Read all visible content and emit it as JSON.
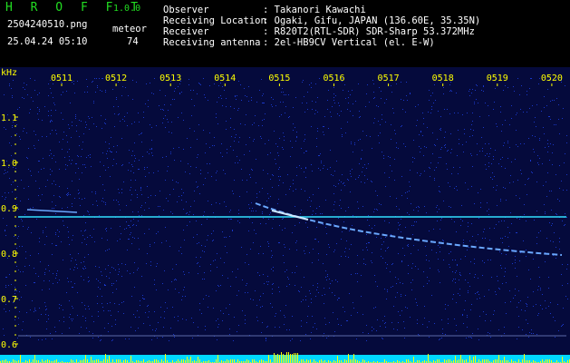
{
  "header": {
    "app_title": "H R O F F T",
    "app_version": "1.0.0",
    "file_name": "2504240510.png",
    "timestamp": "25.04.24 05:10",
    "meteor_label": "meteor",
    "meteor_count": "74",
    "info": [
      {
        "label": "Observer",
        "value": ": Takanori Kawachi"
      },
      {
        "label": "Receiving Location",
        "value": ": Ogaki, Gifu, JAPAN (136.60E, 35.35N)"
      },
      {
        "label": "Receiver",
        "value": ": R820T2(RTL-SDR) SDR-Sharp 53.372MHz"
      },
      {
        "label": "Receiving antenna",
        "value": ": 2el-HB9CV Vertical (el. E-W)"
      }
    ]
  },
  "spectrogram": {
    "y_unit": "kHz",
    "time_labels": [
      "0511",
      "0512",
      "0513",
      "0514",
      "0515",
      "0516",
      "0517",
      "0518",
      "0519",
      "0520"
    ],
    "freq_labels": [
      "1.1",
      "1.0",
      "0.9",
      "0.8",
      "0.7",
      "0.6"
    ],
    "freq_values": [
      1.1,
      1.0,
      0.9,
      0.8,
      0.7,
      0.6
    ],
    "colors": {
      "background": "#050a3c",
      "noise": "#1a38c8",
      "carrier": "#33e0ff",
      "axis_text": "#ffff00",
      "signal_bars": "#ffff00",
      "baseline": "#00d8ff"
    }
  }
}
